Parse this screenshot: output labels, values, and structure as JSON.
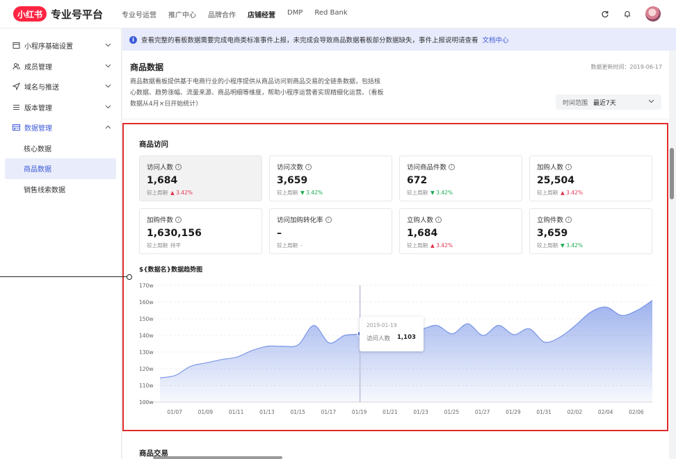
{
  "header": {
    "logo_text": "小红书",
    "app_title": "专业号平台",
    "nav": [
      "专业号运营",
      "推广中心",
      "品牌合作",
      "店铺经营",
      "DMP",
      "Red Bank"
    ],
    "active_nav": "店铺经营",
    "icons": [
      "refresh-icon",
      "bell-icon",
      "avatar"
    ]
  },
  "sidebar": {
    "groups": [
      {
        "label": "小程序基础设置",
        "icon": "storefront-icon",
        "expanded": false
      },
      {
        "label": "成员管理",
        "icon": "users-icon",
        "expanded": false
      },
      {
        "label": "域名与推送",
        "icon": "send-icon",
        "expanded": false
      },
      {
        "label": "版本管理",
        "icon": "list-icon",
        "expanded": false
      },
      {
        "label": "数据管理",
        "icon": "data-icon",
        "expanded": true
      }
    ],
    "sub_items": [
      "核心数据",
      "商品数据",
      "销售线索数据"
    ],
    "selected_sub": "商品数据"
  },
  "notice": {
    "text": "查看完整的看板数据需要完成电商类标准事件上报，未完成会导致商品数据看板部分数据缺失，事件上报说明请查看",
    "link": "文档中心"
  },
  "page": {
    "title": "商品数据",
    "update_time": "数据更新时间：2019-06-17",
    "description": "商品数据看板提供基于电商行业的小程序提供从商品访问到商品交易的全链条数据，包括核心数据、趋势涨幅、流量来源、商品明细等维度，帮助小程序运营者实现精细化运营。（看板数据从4月×日开始统计）",
    "range_label": "时间范围",
    "range_value": "最近7天"
  },
  "visits": {
    "title": "商品访问",
    "compare_label": "较上周期",
    "cards": [
      {
        "label": "访问人数",
        "value": "1,684",
        "delta": "3.42%",
        "trend": "up",
        "selected": true
      },
      {
        "label": "访问次数",
        "value": "3,659",
        "delta": "3.42%",
        "trend": "down",
        "selected": false
      },
      {
        "label": "访问商品件数",
        "value": "672",
        "delta": "3.42%",
        "trend": "down",
        "selected": false
      },
      {
        "label": "加购人数",
        "value": "25,504",
        "delta": "3.42%",
        "trend": "up",
        "selected": false
      },
      {
        "label": "加购件数",
        "value": "1,630,156",
        "delta": "持平",
        "trend": "flat",
        "selected": false
      },
      {
        "label": "访问加购转化率",
        "value": "–",
        "delta": "-",
        "trend": "flat",
        "selected": false
      },
      {
        "label": "立购人数",
        "value": "1,684",
        "delta": "3.42%",
        "trend": "up",
        "selected": false
      },
      {
        "label": "立购件数",
        "value": "3,659",
        "delta": "3.42%",
        "trend": "down",
        "selected": false
      }
    ]
  },
  "chart_data": {
    "type": "area",
    "title": "${数据名}数据趋势图",
    "ylim": [
      100,
      170
    ],
    "yticks": [
      "100w",
      "110w",
      "120w",
      "130w",
      "140w",
      "150w",
      "160w",
      "170w"
    ],
    "xticks": [
      "01/07",
      "01/09",
      "01/11",
      "01/13",
      "01/15",
      "01/17",
      "01/19",
      "01/21",
      "01/23",
      "01/25",
      "01/27",
      "01/29",
      "01/31",
      "02/02",
      "02/04",
      "02/06"
    ],
    "x": [
      0,
      0.5,
      1,
      1.5,
      2,
      2.5,
      3,
      3.5,
      4,
      4.5,
      5,
      5.5,
      6,
      6.5,
      7,
      7.5,
      8,
      8.5,
      9,
      9.5,
      10,
      10.5,
      11,
      11.5,
      12,
      12.5,
      13,
      13.5,
      14,
      14.5,
      15,
      15.5,
      16
    ],
    "values": [
      114.5,
      116,
      121.5,
      123.5,
      125.5,
      127,
      131,
      133.5,
      133.5,
      134.5,
      146,
      135.5,
      140,
      141,
      145,
      146,
      146,
      144,
      146,
      141,
      147,
      140,
      146,
      140.5,
      144,
      136,
      139,
      146,
      154,
      157,
      152,
      155,
      161
    ],
    "accent": "#4e73df",
    "tooltip": {
      "date": "2019-01-19",
      "series": "访问人数",
      "value": "1,103"
    }
  },
  "next_section": {
    "title": "商品交易"
  }
}
